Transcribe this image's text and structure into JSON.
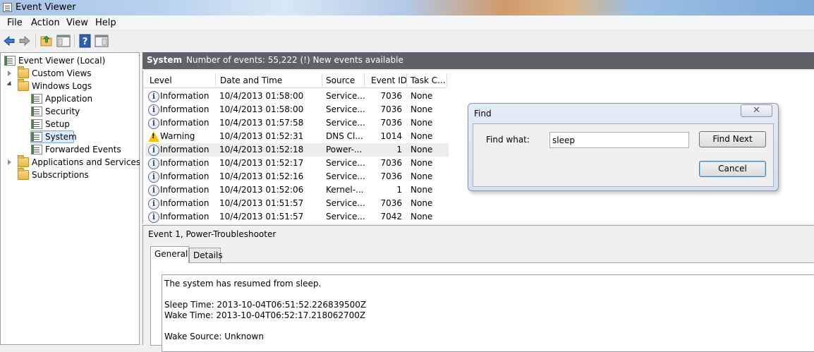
{
  "window": {
    "title": "Event Viewer"
  },
  "menu": [
    "File",
    "Action",
    "View",
    "Help"
  ],
  "tree": {
    "root": "Event Viewer (Local)",
    "custom_views": "Custom Views",
    "windows_logs": "Windows Logs",
    "logs": [
      "Application",
      "Security",
      "Setup",
      "System",
      "Forwarded Events"
    ],
    "apps_services": "Applications and Services Lo",
    "subscriptions": "Subscriptions",
    "selected": "System"
  },
  "header": {
    "log_name": "System",
    "summary": "Number of events: 55,222 (!) New events available"
  },
  "columns": [
    "Level",
    "Date and Time",
    "Source",
    "Event ID",
    "Task C..."
  ],
  "events": [
    {
      "level": "Information",
      "icon": "info-icon",
      "datetime": "10/4/2013 01:58:00",
      "source": "Service...",
      "event_id": "7036",
      "task": "None"
    },
    {
      "level": "Information",
      "icon": "info-icon",
      "datetime": "10/4/2013 01:58:00",
      "source": "Service...",
      "event_id": "7036",
      "task": "None"
    },
    {
      "level": "Information",
      "icon": "info-icon",
      "datetime": "10/4/2013 01:57:58",
      "source": "Service...",
      "event_id": "7036",
      "task": "None"
    },
    {
      "level": "Warning",
      "icon": "warning-icon",
      "datetime": "10/4/2013 01:52:31",
      "source": "DNS Cl...",
      "event_id": "1014",
      "task": "None"
    },
    {
      "level": "Information",
      "icon": "info-icon",
      "datetime": "10/4/2013 01:52:18",
      "source": "Power-...",
      "event_id": "1",
      "task": "None"
    },
    {
      "level": "Information",
      "icon": "info-icon",
      "datetime": "10/4/2013 01:52:17",
      "source": "Service...",
      "event_id": "7036",
      "task": "None"
    },
    {
      "level": "Information",
      "icon": "info-icon",
      "datetime": "10/4/2013 01:52:16",
      "source": "Service...",
      "event_id": "7036",
      "task": "None"
    },
    {
      "level": "Information",
      "icon": "info-icon",
      "datetime": "10/4/2013 01:52:06",
      "source": "Kernel-...",
      "event_id": "1",
      "task": "None"
    },
    {
      "level": "Information",
      "icon": "info-icon",
      "datetime": "10/4/2013 01:51:57",
      "source": "Service...",
      "event_id": "7036",
      "task": "None"
    },
    {
      "level": "Information",
      "icon": "info-icon",
      "datetime": "10/4/2013 01:51:57",
      "source": "Service...",
      "event_id": "7042",
      "task": "None"
    }
  ],
  "detail": {
    "title": "Event 1, Power-Troubleshooter",
    "tabs": [
      "General",
      "Details"
    ],
    "lines": {
      "l1": "The system has resumed from sleep.",
      "l2": "Sleep Time: 2013-10-04T06:51:52.226839500Z",
      "l3": "Wake Time: 2013-10-04T06:52:17.218062700Z",
      "l4": "Wake Source: Unknown"
    }
  },
  "find_dialog": {
    "title": "Find",
    "close_glyph": "✕",
    "label": "Find what:",
    "value": "sleep",
    "find_next": "Find Next",
    "cancel": "Cancel"
  }
}
